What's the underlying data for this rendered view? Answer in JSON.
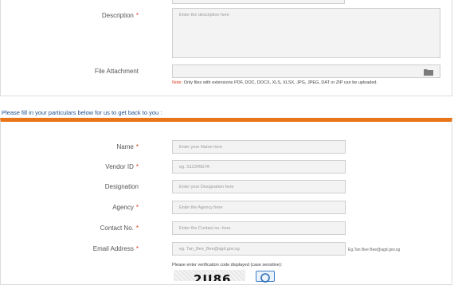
{
  "description": {
    "label": "Description",
    "placeholder": "Enter the description here"
  },
  "attachment": {
    "label": "File Attachment",
    "note_prefix": "Note:",
    "note": "Only files with extensions PDF, DOC, DOCX, XLS, XLSX, JPG, JPEG, DAT or ZIP can be uploaded."
  },
  "particulars_heading": "Please fill in your particulars below for us to get back to you :",
  "required_mark": "*",
  "fields": [
    {
      "label": "Name",
      "placeholder": "Enter your Name here",
      "required": true
    },
    {
      "label": "Vendor ID",
      "placeholder": "eg. S1234567A",
      "required": true
    },
    {
      "label": "Designation",
      "placeholder": "Enter your Designation here",
      "required": false
    },
    {
      "label": "Agency",
      "placeholder": "Enter the Agency here",
      "required": true
    },
    {
      "label": "Contact No.",
      "placeholder": "Enter the Contact no. here",
      "required": true
    },
    {
      "label": "Email Address",
      "placeholder": "eg. Tan_Bee_Bee@agd.gov.sg",
      "required": true
    }
  ],
  "email_hint": "Eg.Tan Bee Bee@agd.gov.sg",
  "verification": {
    "instruction": "Please enter verification code displayed (case sensitive):",
    "code_partial": "2U86"
  },
  "icons": {
    "folder": "folder-icon",
    "refresh": "refresh-icon"
  },
  "colors": {
    "accent": "#e8751a",
    "heading": "#1f4e8c",
    "required": "#d9381e"
  }
}
